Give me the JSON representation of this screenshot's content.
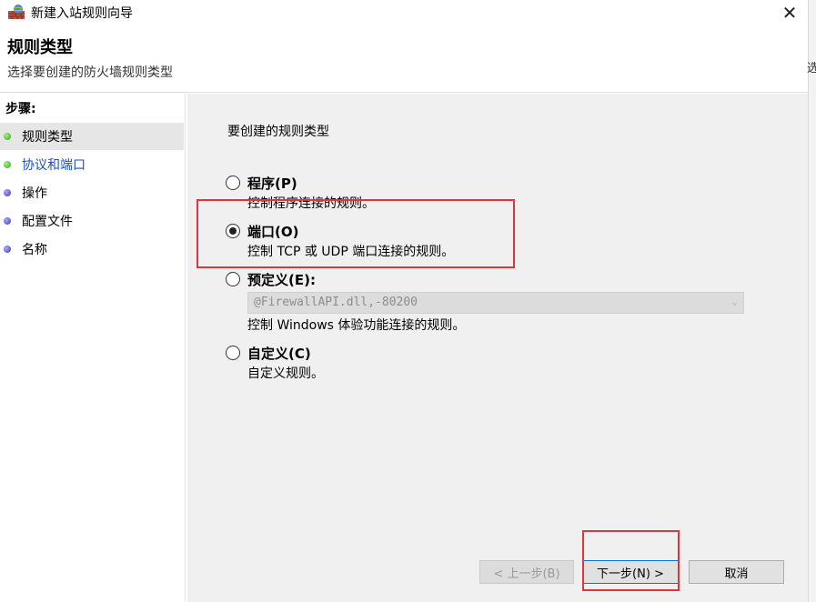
{
  "window": {
    "title": "新建入站规则向导",
    "close_symbol": "✕"
  },
  "header": {
    "title": "规则类型",
    "subtitle": "选择要创建的防火墙规则类型"
  },
  "steps": {
    "label": "步骤:",
    "items": [
      {
        "label": "规则类型",
        "dot": "green",
        "active": true
      },
      {
        "label": "协议和端口",
        "dot": "green",
        "active": false
      },
      {
        "label": "操作",
        "dot": "blue",
        "active": false
      },
      {
        "label": "配置文件",
        "dot": "blue",
        "active": false
      },
      {
        "label": "名称",
        "dot": "blue",
        "active": false
      }
    ]
  },
  "content": {
    "prompt": "要创建的规则类型",
    "options": [
      {
        "label": "程序(P)",
        "desc": "控制程序连接的规则。",
        "checked": false
      },
      {
        "label": "端口(O)",
        "desc": "控制 TCP 或 UDP 端口连接的规则。",
        "checked": true
      },
      {
        "label": "预定义(E):",
        "desc": "",
        "checked": false
      },
      {
        "label": "自定义(C)",
        "desc": "自定义规则。",
        "checked": false
      }
    ],
    "predefined_combo_value": "@FirewallAPI.dll,-80200",
    "predefined_desc": "控制 Windows 体验功能连接的规则。"
  },
  "buttons": {
    "back": "< 上一步(B)",
    "next": "下一步(N) >",
    "cancel": "取消"
  },
  "side_edge_char": "选",
  "colors": {
    "highlight": "#e0353d",
    "link": "#1a4fb5"
  }
}
